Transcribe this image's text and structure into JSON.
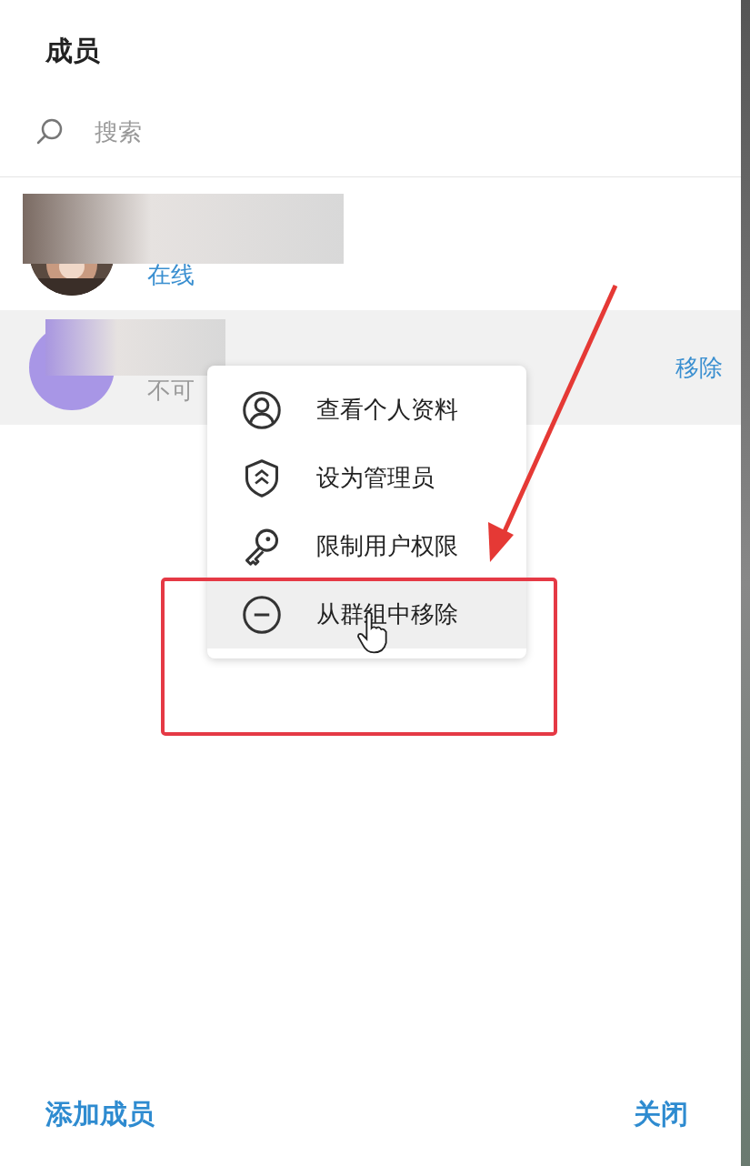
{
  "dialog": {
    "title": "成员",
    "search": {
      "placeholder": "搜索"
    },
    "members": [
      {
        "online": true,
        "status": "在线",
        "hovered": false
      },
      {
        "online": false,
        "status": "不可",
        "hovered": true,
        "kind": "initial",
        "action": "移除"
      }
    ],
    "context_menu": [
      {
        "kind": "profile",
        "label": "查看个人资料",
        "selected": false
      },
      {
        "kind": "admin",
        "label": "设为管理员",
        "selected": false
      },
      {
        "kind": "restrict",
        "label": "限制用户权限",
        "selected": false
      },
      {
        "kind": "remove",
        "label": "从群组中移除",
        "selected": true
      }
    ],
    "footer": {
      "add_button": "添加成员",
      "close_button": "关闭"
    }
  }
}
